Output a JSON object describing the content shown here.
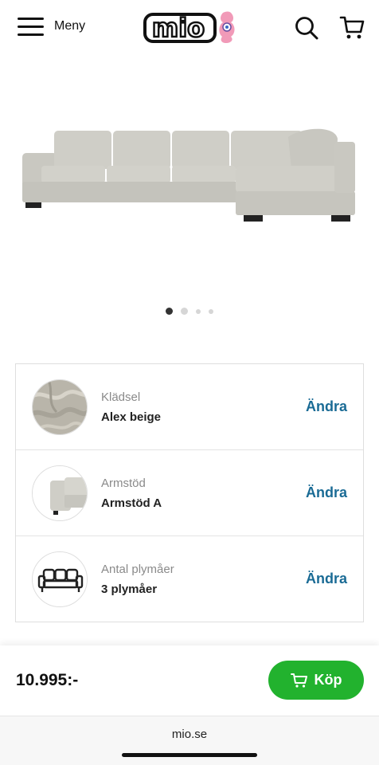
{
  "header": {
    "menu_label": "Meny",
    "logo_text": "mio",
    "icons": [
      "hamburger-icon",
      "search-icon",
      "cart-icon"
    ]
  },
  "gallery": {
    "image": "corner-sofa",
    "slide_count": 4,
    "active_slide": 1
  },
  "options": [
    {
      "label": "Klädsel",
      "value": "Alex beige",
      "action": "Ändra",
      "thumb": "fabric-swatch"
    },
    {
      "label": "Armstöd",
      "value": "Armstöd A",
      "action": "Ändra",
      "thumb": "armrest"
    },
    {
      "label": "Antal plymåer",
      "value": "3 plymåer",
      "action": "Ändra",
      "thumb": "sofa-outline-icon"
    }
  ],
  "purchase": {
    "price": "10.995:-",
    "buy_label": "Köp"
  },
  "browser": {
    "url": "mio.se"
  },
  "colors": {
    "accent_green": "#22b22e",
    "link_blue": "#1a6b95",
    "logo_pink": "#f19ab8"
  }
}
